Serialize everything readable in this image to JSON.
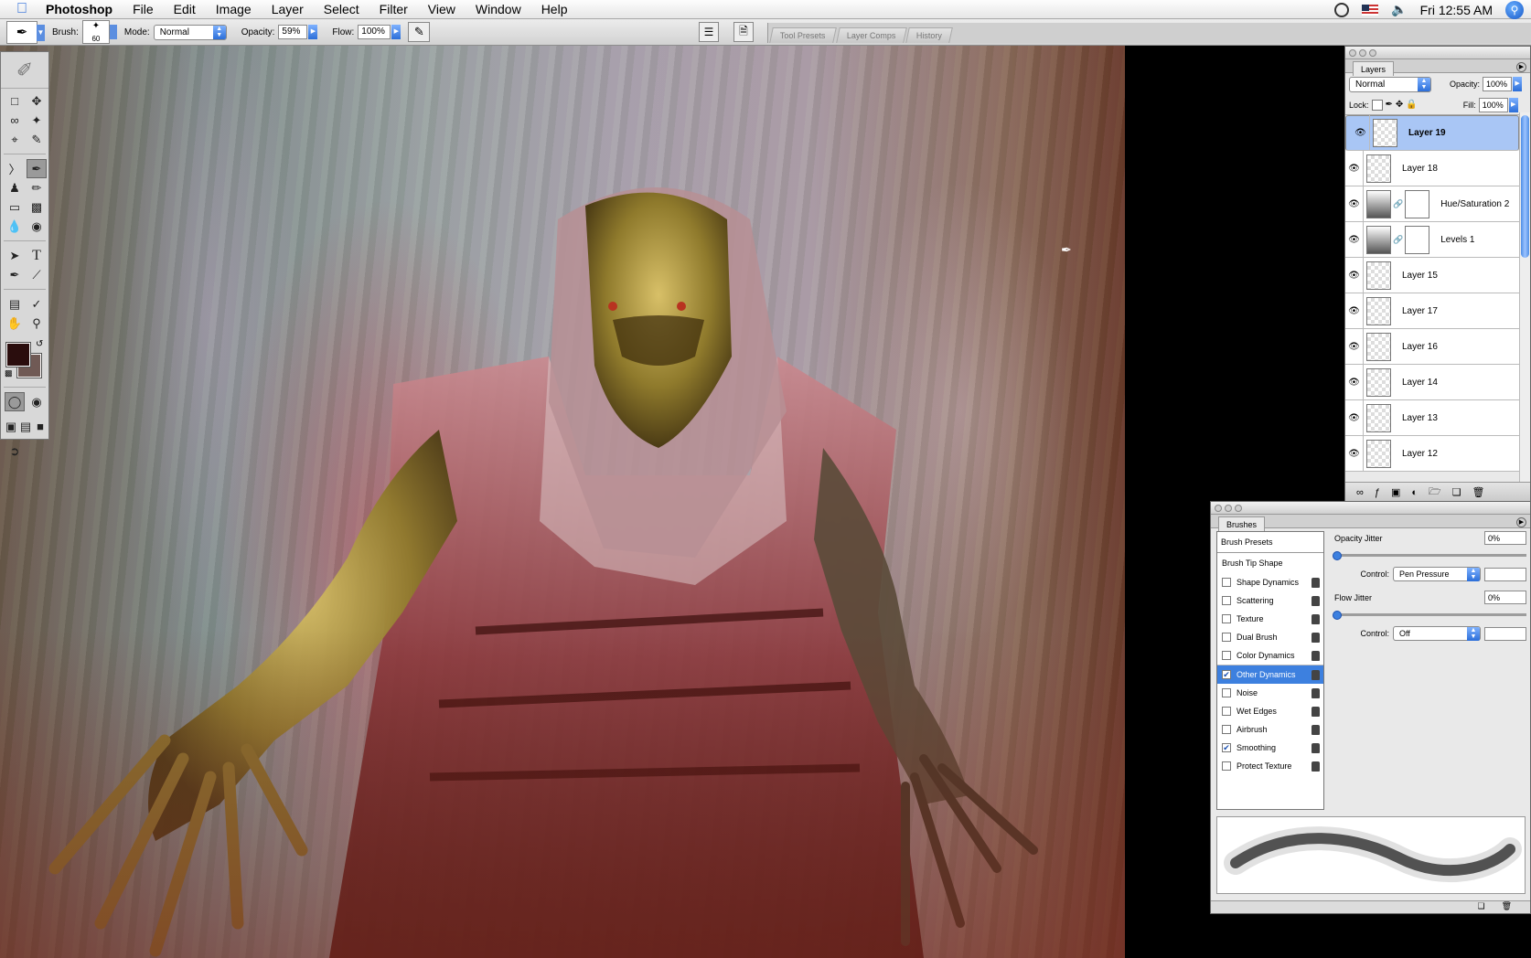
{
  "menubar": {
    "app": "Photoshop",
    "items": [
      "File",
      "Edit",
      "Image",
      "Layer",
      "Select",
      "Filter",
      "View",
      "Window",
      "Help"
    ],
    "clock": "Fri 12:55 AM"
  },
  "options": {
    "brush_label": "Brush:",
    "brush_size": "60",
    "mode_label": "Mode:",
    "mode_value": "Normal",
    "opacity_label": "Opacity:",
    "opacity_value": "59%",
    "flow_label": "Flow:",
    "flow_value": "100%",
    "well_tabs": [
      "Tool Presets",
      "Layer Comps",
      "History"
    ]
  },
  "layers_panel": {
    "tab": "Layers",
    "blend_mode": "Normal",
    "opacity_label": "Opacity:",
    "opacity_value": "100%",
    "lock_label": "Lock:",
    "fill_label": "Fill:",
    "fill_value": "100%",
    "layers": [
      {
        "name": "Layer 19",
        "selected": true,
        "kind": "pixel"
      },
      {
        "name": "Layer 18",
        "kind": "pixel"
      },
      {
        "name": "Hue/Saturation 2",
        "kind": "adjustment"
      },
      {
        "name": "Levels 1",
        "kind": "adjustment"
      },
      {
        "name": "Layer 15",
        "kind": "pixel"
      },
      {
        "name": "Layer 17",
        "kind": "pixel"
      },
      {
        "name": "Layer 16",
        "kind": "pixel"
      },
      {
        "name": "Layer 14",
        "kind": "pixel"
      },
      {
        "name": "Layer 13",
        "kind": "pixel"
      },
      {
        "name": "Layer 12",
        "kind": "pixel"
      }
    ]
  },
  "brushes_panel": {
    "tab": "Brushes",
    "presets_label": "Brush Presets",
    "tip_label": "Brush Tip Shape",
    "options": [
      {
        "name": "Shape Dynamics",
        "checked": false
      },
      {
        "name": "Scattering",
        "checked": false
      },
      {
        "name": "Texture",
        "checked": false
      },
      {
        "name": "Dual Brush",
        "checked": false
      },
      {
        "name": "Color Dynamics",
        "checked": false
      },
      {
        "name": "Other Dynamics",
        "checked": true,
        "highlight": true
      },
      {
        "name": "Noise",
        "checked": false
      },
      {
        "name": "Wet Edges",
        "checked": false
      },
      {
        "name": "Airbrush",
        "checked": false
      },
      {
        "name": "Smoothing",
        "checked": true
      },
      {
        "name": "Protect Texture",
        "checked": false
      }
    ],
    "opacity_jitter_label": "Opacity Jitter",
    "opacity_jitter_value": "0%",
    "control_label": "Control:",
    "control1_value": "Pen Pressure",
    "flow_jitter_label": "Flow Jitter",
    "flow_jitter_value": "0%",
    "control2_value": "Off"
  },
  "colors": {
    "foreground": "#2a0d0d",
    "background": "#705a55",
    "selection": "#a9c6f5",
    "highlight": "#3d80df"
  }
}
